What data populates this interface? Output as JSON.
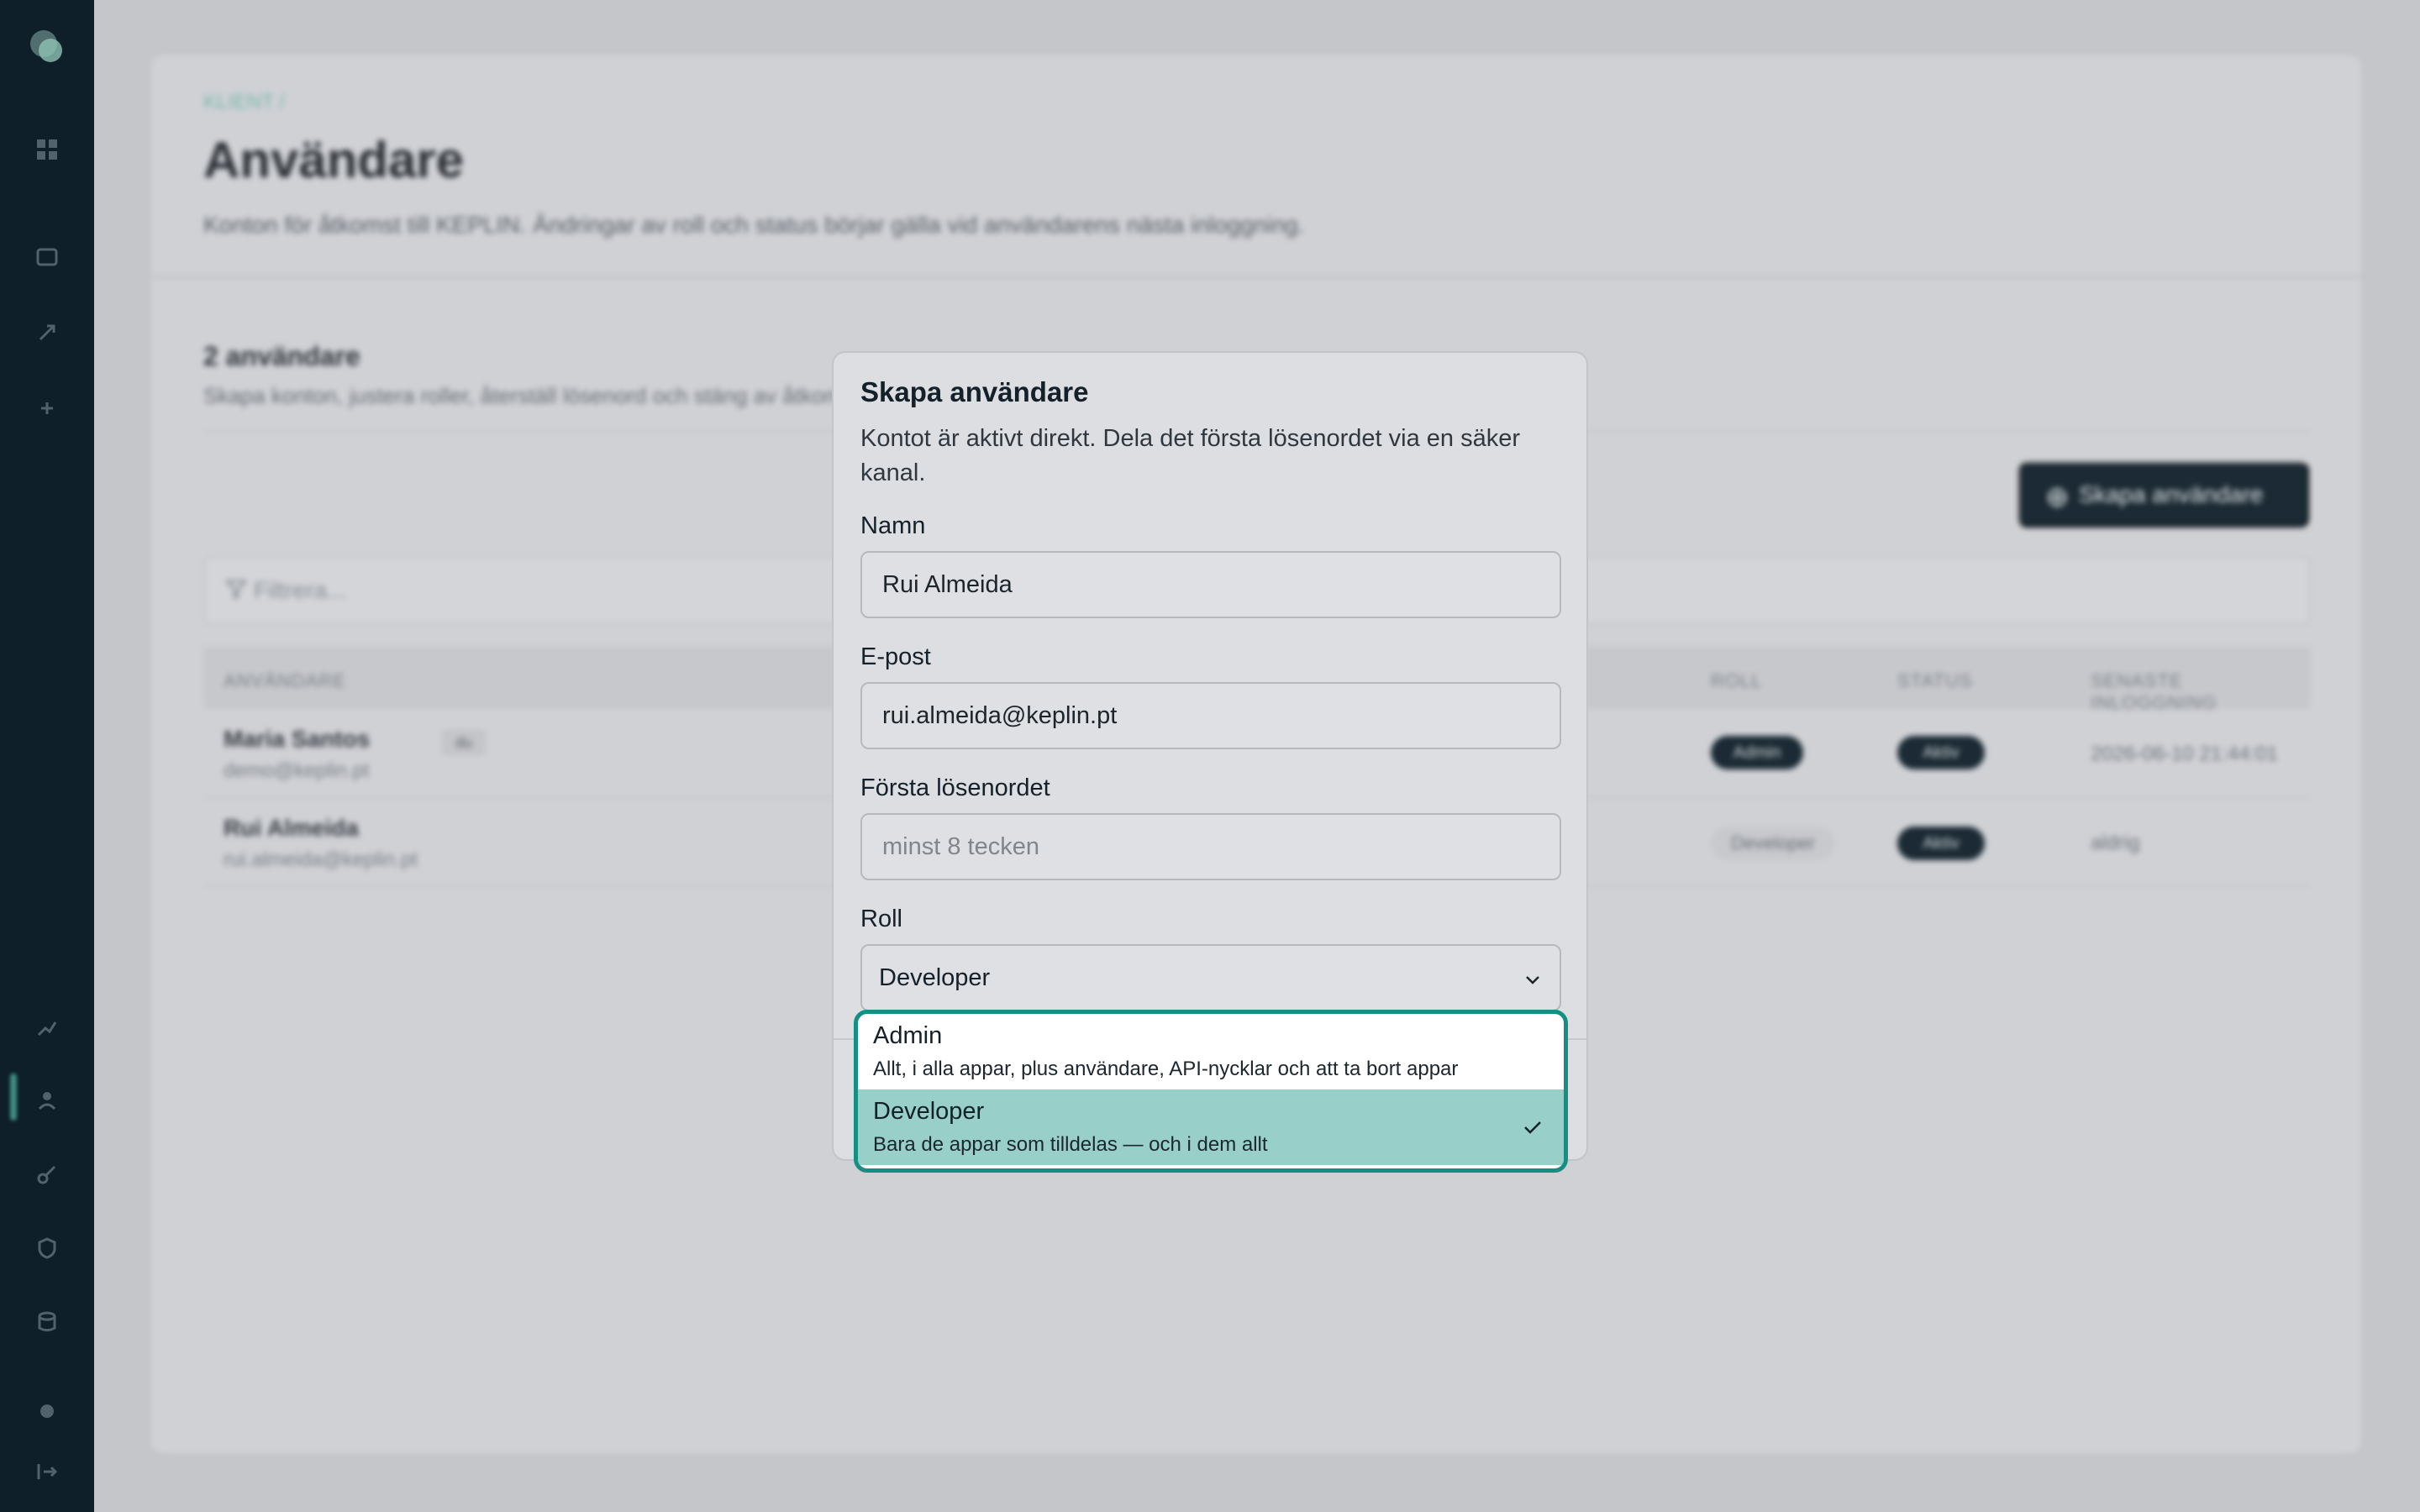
{
  "background": {
    "breadcrumb": "KLIENT /",
    "page_title": "Användare",
    "page_subtitle": "Konton för åtkomst till KEPLIN. Ändringar av roll och status börjar gälla vid användarens nästa inloggning.",
    "count_title": "2 användare",
    "count_subtitle": "Skapa konton, justera roller, återställ lösenord och stäng av åtkomst.",
    "create_button": "Skapa användare",
    "filter_placeholder": "Filtrera...",
    "columns": [
      "ANVÄNDARE",
      "ROLL",
      "STATUS",
      "SENASTE INLOGGNING"
    ],
    "rows": [
      {
        "name": "Maria Santos",
        "email": "demo@keplin.pt",
        "you": "du",
        "role": "Admin",
        "status": "Aktiv",
        "last_login": "2026-06-10 21:44:01"
      },
      {
        "name": "Rui Almeida",
        "email": "rui.almeida@keplin.pt",
        "role": "Developer",
        "status": "Aktiv",
        "last_login": "aldrig"
      }
    ]
  },
  "modal": {
    "title": "Skapa användare",
    "description": "Kontot är aktivt direkt. Dela det första lösenordet via en säker kanal.",
    "name_label": "Namn",
    "name_value": "Rui Almeida",
    "email_label": "E-post",
    "email_value": "rui.almeida@keplin.pt",
    "password_label": "Första lösenordet",
    "password_placeholder": "minst 8 tecken",
    "role_label": "Roll",
    "role_value": "Developer"
  },
  "role_options": [
    {
      "title": "Admin",
      "description": "Allt, i alla appar, plus användare, API-nycklar och att ta bort appar",
      "selected": false
    },
    {
      "title": "Developer",
      "description": "Bara de appar som tilldelas — och i dem allt",
      "selected": true
    }
  ],
  "colors": {
    "accent": "#158f84",
    "selected_bg": "#98cfc8",
    "sidebar": "#0e1f29"
  }
}
